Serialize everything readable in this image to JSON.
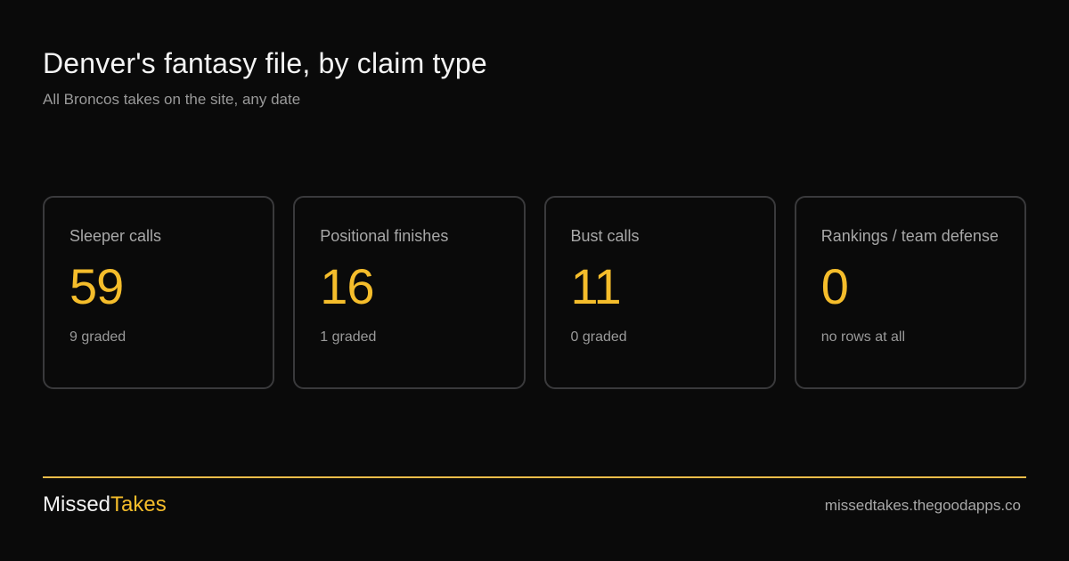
{
  "header": {
    "title": "Denver's fantasy file, by claim type",
    "subtitle": "All Broncos takes on the site, any date"
  },
  "cards": [
    {
      "label": "Sleeper calls",
      "value": "59",
      "note": "9 graded"
    },
    {
      "label": "Positional finishes",
      "value": "16",
      "note": "1 graded"
    },
    {
      "label": "Bust calls",
      "value": "11",
      "note": "0 graded"
    },
    {
      "label": "Rankings / team defense",
      "value": "0",
      "note": "no rows at all"
    }
  ],
  "footer": {
    "brand_part1": "Missed",
    "brand_part2": "Takes",
    "url": "missedtakes.thegoodapps.co"
  },
  "colors": {
    "background": "#0a0a0a",
    "accent": "#f5bd2b",
    "card_border": "#3a3a3c",
    "muted_text": "#9a9a9a"
  }
}
